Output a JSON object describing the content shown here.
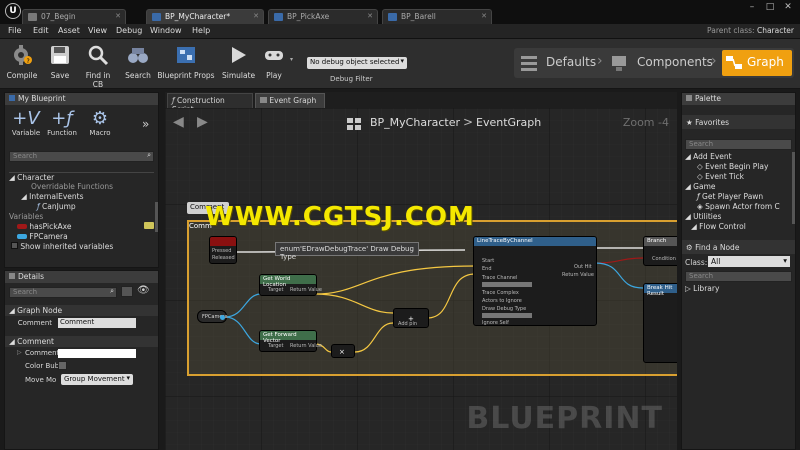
{
  "tabs": [
    {
      "label": "07_Begin"
    },
    {
      "label": "BP_MyCharacter*"
    },
    {
      "label": "BP_PickAxe"
    },
    {
      "label": "BP_Barell"
    }
  ],
  "menu": [
    "File",
    "Edit",
    "Asset",
    "View",
    "Debug",
    "Window",
    "Help"
  ],
  "parent_class": {
    "label": "Parent class:",
    "value": "Character"
  },
  "toolbar": {
    "compile": "Compile",
    "save": "Save",
    "find_in_cb": "Find in CB",
    "search": "Search",
    "blueprint_props": "Blueprint Props",
    "simulate": "Simulate",
    "play": "Play",
    "debug_select": "No debug object selected",
    "debug_filter": "Debug Filter"
  },
  "modes": {
    "defaults": "Defaults",
    "components": "Components",
    "graph": "Graph"
  },
  "my_blueprint": {
    "title": "My Blueprint",
    "buttons": {
      "variable": "Variable",
      "function": "Function",
      "macro": "Macro"
    },
    "search_placeholder": "Search",
    "tree": {
      "character": "Character",
      "overridable": "Overridable Functions",
      "internal_events": "InternalEvents",
      "can_jump": "CanJump",
      "variables": "Variables",
      "has_pick_axe": "hasPickAxe",
      "fp_camera": "FPCamera",
      "show_inherited": "Show inherited variables"
    }
  },
  "details": {
    "title": "Details",
    "search_placeholder": "Search",
    "graph_node_section": "Graph Node",
    "comment_label": "Comment",
    "comment_value": "Comment",
    "comment_section": "Comment",
    "comment2_label": "Comment",
    "color_bubble_label": "Color Bub",
    "move_mode_label": "Move Mo",
    "move_mode_value": "Group Movement"
  },
  "graph_tabs": {
    "construction": "Construction Script",
    "event_graph": "Event Graph"
  },
  "graph_header": {
    "bp": "BP_MyCharacter",
    "sep": ">",
    "graph": "EventGraph",
    "zoom": "Zoom -4"
  },
  "graph": {
    "comment_bubble": "Comment",
    "comment_title": "Comm",
    "tooltip": "enum'EDrawDebugTrace' Draw Debug Type",
    "watermark": "BLUEPRINT",
    "overlay": "WWW.CGTSJ.COM",
    "nodes": {
      "fp_camera": "FPCamera",
      "get_world_location": "Get World Location",
      "get_forward_vector": "Get Forward Vector",
      "target": "Target",
      "return_value": "Return Value",
      "add": "Add pin",
      "line_trace": "LineTraceByChannel",
      "start": "Start",
      "end": "End",
      "trace_channel": "Trace Channel",
      "trace_complex": "Trace Complex",
      "actors_ignore": "Actors to Ignore",
      "draw_debug": "Draw Debug Type",
      "ignore_self": "Ignore Self",
      "out_hit": "Out Hit",
      "branch": "Branch",
      "condition": "Condition",
      "break_hit": "Break Hit Result",
      "pressed": "Pressed",
      "released": "Released"
    }
  },
  "palette": {
    "title": "Palette",
    "favorites": "Favorites",
    "search_placeholder": "Search",
    "add_event": "Add Event",
    "event_begin_play": "Event Begin Play",
    "event_tick": "Event Tick",
    "game": "Game",
    "get_player_pawn": "Get Player Pawn",
    "spawn_actor": "Spawn Actor from C",
    "utilities": "Utilities",
    "flow_control": "Flow Control",
    "find_node": "Find a Node",
    "class_label": "Class:",
    "class_value": "All",
    "search2_placeholder": "Search",
    "library": "Library"
  },
  "colors": {
    "accent": "#f0a010",
    "comment_border": "#d9a030",
    "exec_white": "#ffffff",
    "vector_yellow": "#f5c842",
    "object_blue": "#3ca7e0",
    "bool_red": "#a01818"
  }
}
